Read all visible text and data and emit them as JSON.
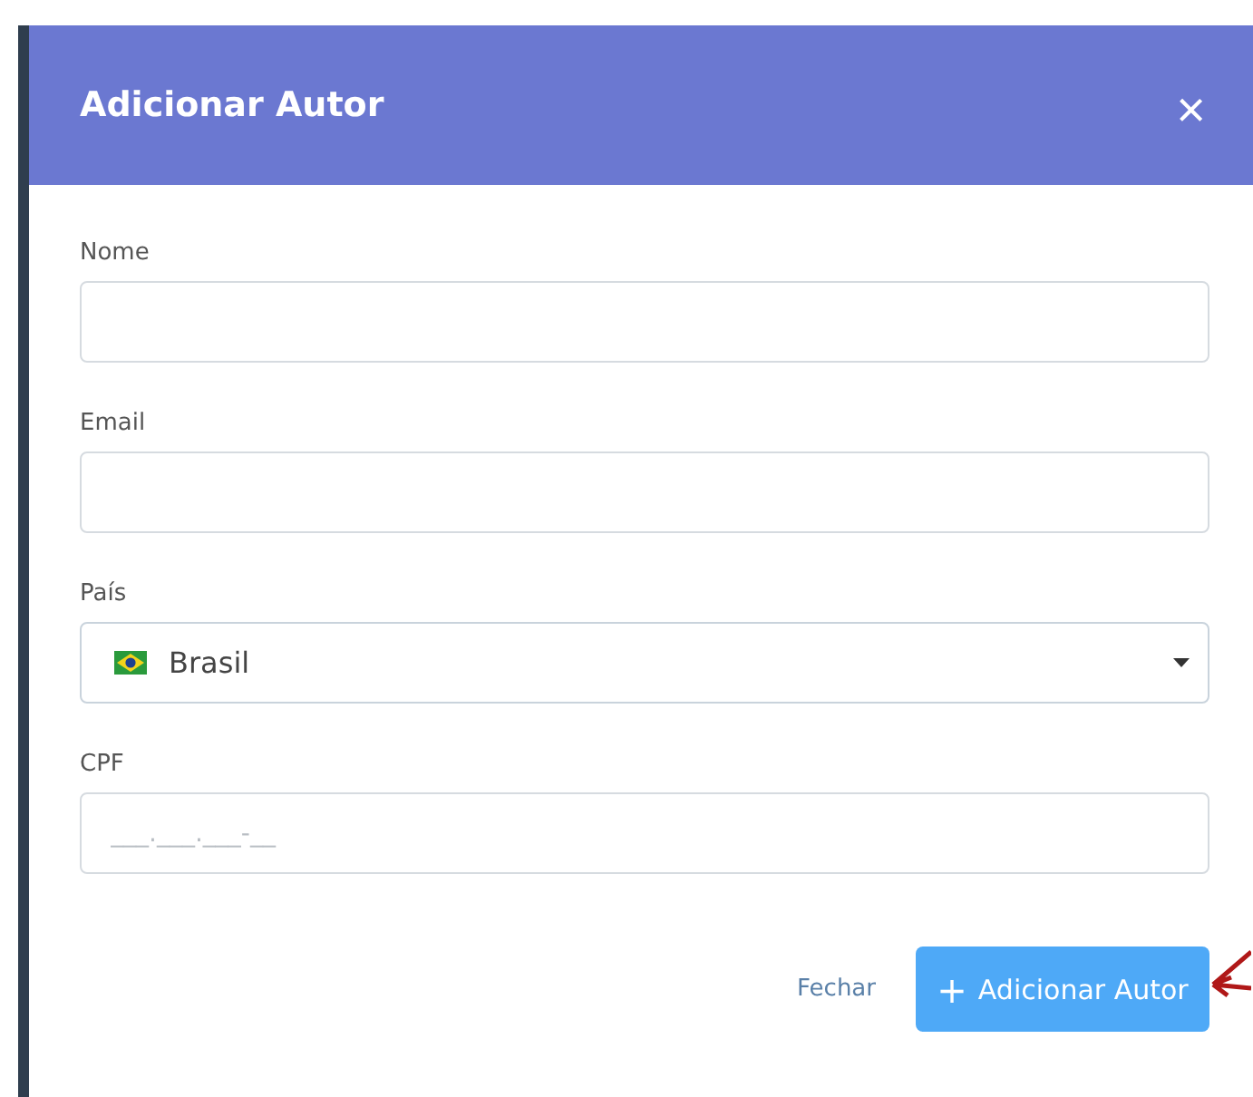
{
  "dialog": {
    "title": "Adicionar Autor",
    "close": "×"
  },
  "fields": [
    {
      "kind": "text",
      "label": "Nome"
    },
    {
      "kind": "text",
      "label": "Email"
    },
    {
      "kind": "select",
      "label": "País",
      "value": "Brasil"
    },
    {
      "kind": "text",
      "label": "CPF",
      "placeholder": "___.___.___-__"
    }
  ],
  "buttons": {
    "cancel": "Fechar",
    "submit_icon": "+",
    "submit": "Adicionar Autor"
  }
}
